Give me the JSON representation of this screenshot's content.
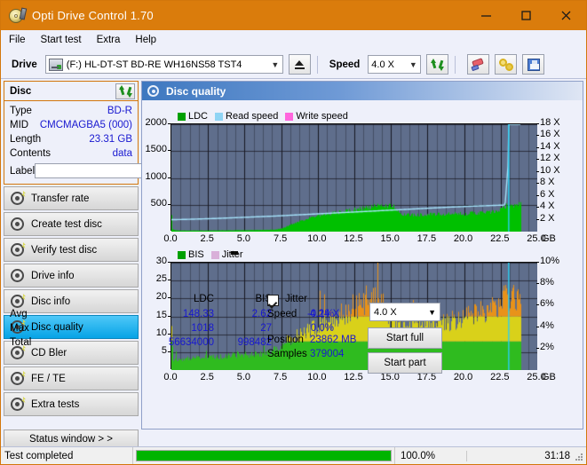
{
  "window": {
    "title": "Opti Drive Control 1.70",
    "icon": "disc-drive-icon",
    "minimize_label": "—",
    "maximize_label": "□",
    "close_label": "✕",
    "titlebar_color": "#da7c0c"
  },
  "menubar": {
    "items": [
      {
        "label": "File"
      },
      {
        "label": "Start test"
      },
      {
        "label": "Extra"
      },
      {
        "label": "Help"
      }
    ]
  },
  "toolbar": {
    "drive_label": "Drive",
    "drive_value": "(F:)  HL-DT-ST BD-RE  WH16NS58 TST4",
    "eject_icon": "eject-icon",
    "speed_label": "Speed",
    "speed_value": "4.0 X",
    "refresh_icon": "refresh-icon",
    "erase_icon": "eraser-icon",
    "rings_icon": "gold-rings-icon",
    "save_icon": "floppy-save-icon"
  },
  "sidebar": {
    "disc_panel": {
      "title": "Disc",
      "refresh_icon": "refresh-icon",
      "rows": [
        {
          "key": "Type",
          "value": "BD-R"
        },
        {
          "key": "MID",
          "value": "CMCMAGBA5 (000)"
        },
        {
          "key": "Length",
          "value": "23.31 GB"
        },
        {
          "key": "Contents",
          "value": "data"
        }
      ],
      "label_key": "Label",
      "label_value": "",
      "label_placeholder": "",
      "label_button_icon": "disc-icon"
    },
    "items": [
      {
        "label": "Transfer rate",
        "icon": "disc-test-icon",
        "active": false
      },
      {
        "label": "Create test disc",
        "icon": "disc-write-icon",
        "active": false
      },
      {
        "label": "Verify test disc",
        "icon": "disc-verify-icon",
        "active": false
      },
      {
        "label": "Drive info",
        "icon": "drive-info-icon",
        "active": false
      },
      {
        "label": "Disc info",
        "icon": "disc-info-icon",
        "active": false
      },
      {
        "label": "Disc quality",
        "icon": "disc-quality-icon",
        "active": true
      },
      {
        "label": "CD Bler",
        "icon": "cd-bler-icon",
        "active": false
      },
      {
        "label": "FE / TE",
        "icon": "fe-te-icon",
        "active": false
      },
      {
        "label": "Extra tests",
        "icon": "extra-tests-icon",
        "active": false
      }
    ],
    "status_window_label": "Status window > >"
  },
  "panel": {
    "title": "Disc quality",
    "icon": "disc-quality-icon"
  },
  "stats": {
    "col_headers": [
      "LDC",
      "BIS"
    ],
    "jitter_label": "Jitter",
    "jitter_checked": true,
    "rows": [
      {
        "label": "Avg",
        "ldc": "148.33",
        "bis": "2.62",
        "jitter": "-0.1%"
      },
      {
        "label": "Max",
        "ldc": "1018",
        "bis": "27",
        "jitter": "0.0%"
      },
      {
        "label": "Total",
        "ldc": "56634000",
        "bis": "998482",
        "jitter": ""
      }
    ],
    "speed_label": "Speed",
    "speed_value": "4.24 X",
    "position_label": "Position",
    "position_value": "23862 MB",
    "samples_label": "Samples",
    "samples_value": "379004",
    "speed_select_value": "4.0 X",
    "start_full_label": "Start full",
    "start_part_label": "Start part"
  },
  "statusbar": {
    "text": "Test completed",
    "progress_percent": 100.0,
    "percent_label": "100.0%",
    "elapsed": "31:18"
  },
  "chart_data": [
    {
      "type": "area",
      "name": "disc-quality-ldc",
      "title": "",
      "xlabel": "GB",
      "ylabel": "LDC",
      "xlim": [
        0.0,
        25.0
      ],
      "xticks": [
        "0.0",
        "2.5",
        "5.0",
        "7.5",
        "10.0",
        "12.5",
        "15.0",
        "17.5",
        "20.0",
        "22.5",
        "25.0"
      ],
      "x_unit_label": "GB",
      "ylim": [
        0,
        2000
      ],
      "yticks": [
        500,
        1000,
        1500,
        2000
      ],
      "y2lim": [
        0,
        18
      ],
      "y2ticks": [
        "2 X",
        "4 X",
        "6 X",
        "8 X",
        "10 X",
        "12 X",
        "14 X",
        "16 X",
        "18 X"
      ],
      "grid": true,
      "plot_bg": "#5f6e8c",
      "legend_position": "top-left",
      "legend": [
        {
          "name": "LDC",
          "color": "#00a000"
        },
        {
          "name": "Read speed",
          "color": "#8fd4f4"
        },
        {
          "name": "Write speed",
          "color": "#ff66dd"
        }
      ],
      "data_end_x": 23.9,
      "ldc_profile": [
        [
          0.0,
          330
        ],
        [
          0.05,
          40
        ],
        [
          0.3,
          20
        ],
        [
          1.0,
          18
        ],
        [
          2.0,
          18
        ],
        [
          3.0,
          20
        ],
        [
          4.0,
          22
        ],
        [
          5.0,
          25
        ],
        [
          6.0,
          28
        ],
        [
          7.0,
          35
        ],
        [
          7.6,
          60
        ],
        [
          8.0,
          110
        ],
        [
          8.6,
          175
        ],
        [
          9.2,
          230
        ],
        [
          10.0,
          280
        ],
        [
          11.0,
          330
        ],
        [
          12.0,
          370
        ],
        [
          13.0,
          420
        ],
        [
          14.0,
          455
        ],
        [
          14.6,
          470
        ],
        [
          15.2,
          455
        ],
        [
          15.8,
          300
        ],
        [
          16.5,
          300
        ],
        [
          17.5,
          310
        ],
        [
          18.5,
          310
        ],
        [
          19.5,
          320
        ],
        [
          20.5,
          330
        ],
        [
          21.5,
          345
        ],
        [
          22.3,
          360
        ],
        [
          22.9,
          470
        ],
        [
          23.5,
          480
        ],
        [
          23.9,
          500
        ]
      ],
      "read_speed_profile": [
        [
          0.0,
          2.0
        ],
        [
          1.0,
          2.05
        ],
        [
          3.0,
          2.2
        ],
        [
          5.0,
          2.4
        ],
        [
          7.0,
          2.6
        ],
        [
          9.0,
          2.85
        ],
        [
          11.0,
          3.1
        ],
        [
          13.0,
          3.35
        ],
        [
          15.0,
          3.6
        ],
        [
          17.0,
          3.85
        ],
        [
          19.0,
          4.1
        ],
        [
          21.0,
          4.3
        ],
        [
          22.8,
          4.45
        ],
        [
          23.0,
          11.0
        ],
        [
          23.05,
          18.0
        ],
        [
          23.1,
          18.0
        ]
      ],
      "cursor_x": 23.05,
      "cursor_color": "#29d0f5"
    },
    {
      "type": "bar",
      "name": "disc-quality-bis-jitter",
      "title": "",
      "xlabel": "GB",
      "ylabel": "BIS",
      "xlim": [
        0.0,
        25.0
      ],
      "xticks": [
        "0.0",
        "2.5",
        "5.0",
        "7.5",
        "10.0",
        "12.5",
        "15.0",
        "17.5",
        "20.0",
        "22.5",
        "25.0"
      ],
      "x_unit_label": "GB",
      "ylim": [
        0,
        30
      ],
      "yticks": [
        5,
        10,
        15,
        20,
        25,
        30
      ],
      "y2lim": [
        0,
        10
      ],
      "y2ticks": [
        "2%",
        "4%",
        "6%",
        "8%",
        "10%"
      ],
      "grid": true,
      "plot_bg": "#5f6e8c",
      "legend_position": "top-left",
      "legend": [
        {
          "name": "BIS",
          "color": "#00a000"
        },
        {
          "name": "Jitter",
          "color": "#d9b0d9"
        }
      ],
      "data_end_x": 23.9,
      "bis_profile": [
        [
          0.0,
          11
        ],
        [
          0.1,
          3
        ],
        [
          0.6,
          3
        ],
        [
          1.5,
          3.2
        ],
        [
          2.5,
          3.5
        ],
        [
          3.5,
          3.6
        ],
        [
          4.5,
          4.0
        ],
        [
          5.5,
          4.2
        ],
        [
          6.5,
          4.6
        ],
        [
          7.0,
          5.5
        ],
        [
          7.6,
          7.0
        ],
        [
          8.3,
          8.5
        ],
        [
          9.0,
          10.0
        ],
        [
          9.8,
          11.5
        ],
        [
          10.6,
          13.0
        ],
        [
          11.4,
          14.5
        ],
        [
          12.2,
          16.0
        ],
        [
          13.0,
          17.5
        ],
        [
          13.8,
          18.5
        ],
        [
          14.4,
          19.0
        ],
        [
          15.0,
          12.5
        ],
        [
          16.0,
          12.0
        ],
        [
          17.0,
          12.5
        ],
        [
          18.0,
          12.5
        ],
        [
          19.0,
          13.0
        ],
        [
          20.0,
          14.0
        ],
        [
          21.0,
          15.0
        ],
        [
          22.0,
          16.5
        ],
        [
          22.8,
          19.5
        ],
        [
          23.4,
          20.5
        ],
        [
          23.9,
          20.0
        ]
      ],
      "bar_color_low": "#2fbb1f",
      "bar_color_mid": "#d9d11a",
      "bar_color_high": "#e8921a",
      "cursor_x": 23.05,
      "cursor_color": "#29d0f5"
    }
  ]
}
